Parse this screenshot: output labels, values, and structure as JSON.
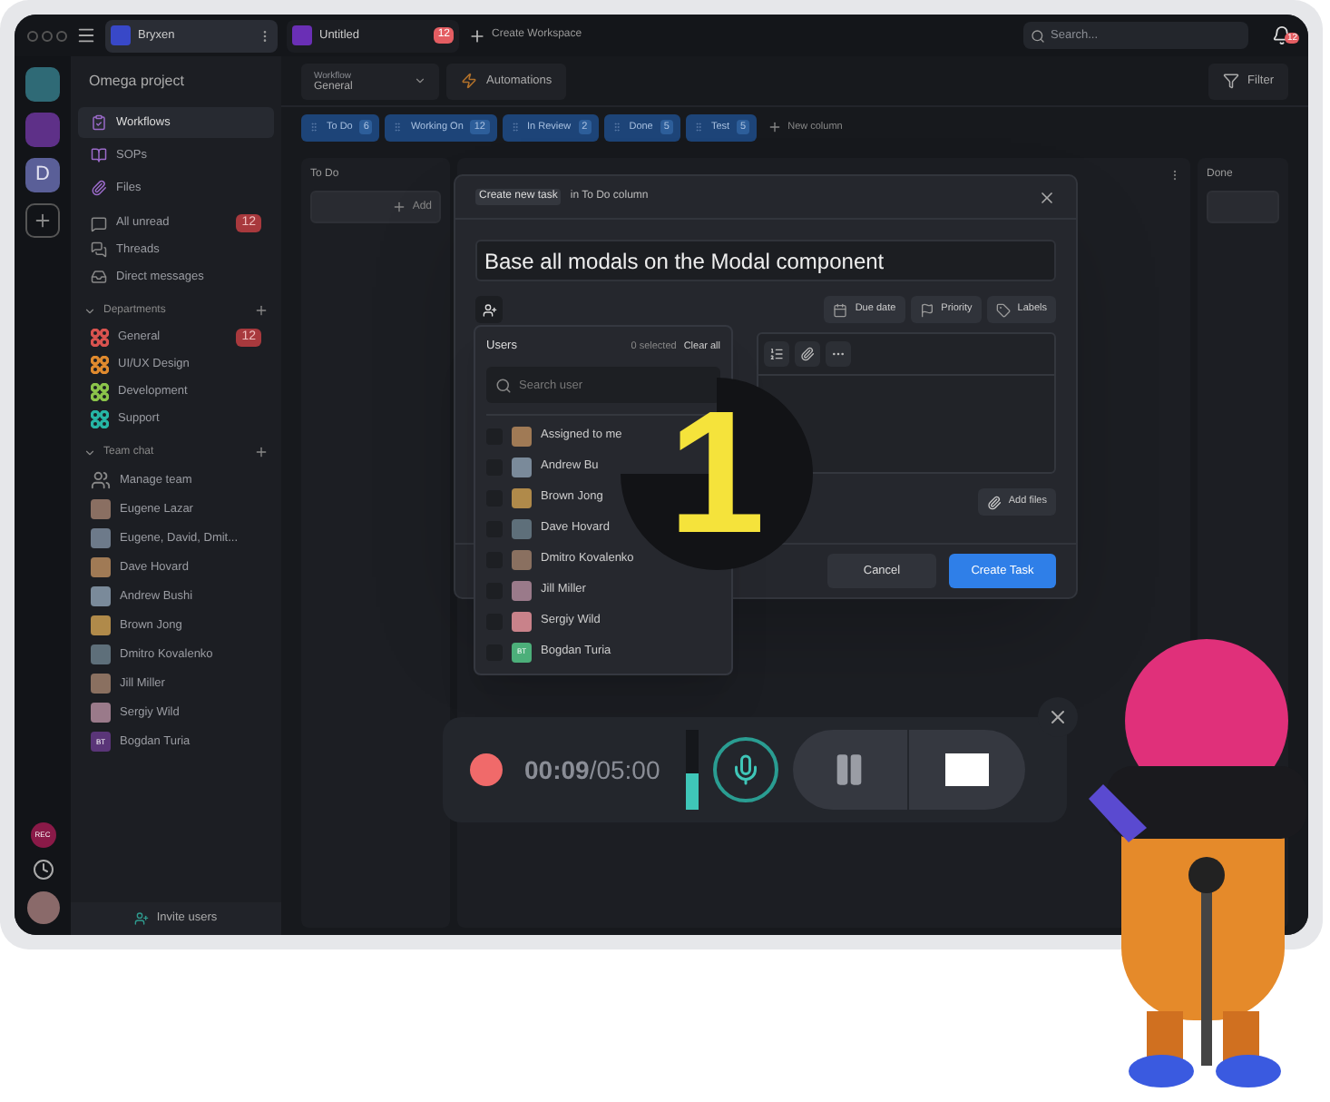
{
  "top_bar": {
    "workspaces": [
      {
        "name": "Bryxen",
        "selected": true
      },
      {
        "name": "Untitled",
        "selected": false,
        "badge": "12"
      }
    ],
    "create_label": "Create Workspace",
    "search": {
      "placeholder": "Search..."
    },
    "notifications_badge": "12"
  },
  "rail": {
    "workspaces": [
      {
        "kind": "logo"
      },
      {
        "kind": "logo"
      },
      {
        "kind": "letter",
        "letter": "D"
      }
    ],
    "rec_label": "REC"
  },
  "sidebar": {
    "project": "Omega project",
    "nav": [
      {
        "label": "Workflows",
        "selected": true
      },
      {
        "label": "SOPs",
        "selected": false
      },
      {
        "label": "Files",
        "selected": false
      }
    ],
    "inbox": [
      {
        "label": "All unread",
        "badge": "12"
      },
      {
        "label": "Threads"
      },
      {
        "label": "Direct messages"
      }
    ],
    "departments": {
      "title": "Departments",
      "expanded": true,
      "items": [
        {
          "label": "General",
          "color": "#d9534f",
          "badge": "12"
        },
        {
          "label": "UI/UX Design",
          "color": "#e08a2e"
        },
        {
          "label": "Development",
          "color": "#8bc34a"
        },
        {
          "label": "Support",
          "color": "#26b5a5"
        }
      ]
    },
    "team_chat": {
      "title": "Team chat",
      "expanded": true,
      "items": [
        {
          "kind": "team",
          "label": "Manage team"
        },
        {
          "kind": "avatar",
          "label": "Eugene Lazar"
        },
        {
          "kind": "avatar",
          "label": "Eugene, David, Dmit..."
        },
        {
          "kind": "avatar",
          "label": "Dave Hovard"
        },
        {
          "kind": "avatar",
          "label": "Andrew Bushi"
        },
        {
          "kind": "avatar",
          "label": "Brown Jong"
        },
        {
          "kind": "avatar",
          "label": "Dmitro Kovalenko"
        },
        {
          "kind": "avatar",
          "label": "Jill Miller"
        },
        {
          "kind": "avatar",
          "label": "Sergiy Wild"
        },
        {
          "kind": "initials",
          "label": "Bogdan Turia",
          "initials": "BT"
        }
      ]
    },
    "invite": "Invite users"
  },
  "toolbar": {
    "workflow_label": "Workflow",
    "workflow_value": "General",
    "automations": "Automations",
    "filter": "Filter"
  },
  "columns": [
    {
      "label": "To Do",
      "count": "6"
    },
    {
      "label": "Working On",
      "count": "12"
    },
    {
      "label": "In Review",
      "count": "2"
    },
    {
      "label": "Done",
      "count": "5"
    },
    {
      "label": "Test",
      "count": "5"
    }
  ],
  "new_column": "New column",
  "board": {
    "columns": [
      {
        "title": "To Do",
        "add": "Add"
      },
      {
        "title": "Done"
      }
    ]
  },
  "modal": {
    "chip": "Create new task",
    "context": "in To Do column",
    "title_value": "Base all modals on the Modal component",
    "actions": [
      "Due date",
      "Priority",
      "Labels"
    ],
    "add_files": "Add files",
    "cancel": "Cancel",
    "create": "Create Task"
  },
  "users_dropdown": {
    "title": "Users",
    "selected_count": "0 selected",
    "clear": "Clear all",
    "search": {
      "placeholder": "Search user"
    },
    "users": [
      {
        "kind": "avatar",
        "name": "Assigned to me",
        "checked": false
      },
      {
        "kind": "avatar",
        "name": "Andrew Bu",
        "checked": false
      },
      {
        "kind": "avatar",
        "name": "Brown Jong",
        "checked": false
      },
      {
        "kind": "avatar",
        "name": "Dave Hovard",
        "checked": false
      },
      {
        "kind": "avatar",
        "name": "Dmitro Kovalenko",
        "checked": false
      },
      {
        "kind": "avatar",
        "name": "Jill Miller",
        "checked": false
      },
      {
        "kind": "avatar",
        "name": "Sergiy Wild",
        "checked": false
      },
      {
        "kind": "initials",
        "name": "Bogdan Turia",
        "initials": "BT",
        "checked": false
      }
    ]
  },
  "step_badge": "1",
  "recorder": {
    "time": "**00:09**/05:00",
    "level": 0.45,
    "paused": false
  }
}
